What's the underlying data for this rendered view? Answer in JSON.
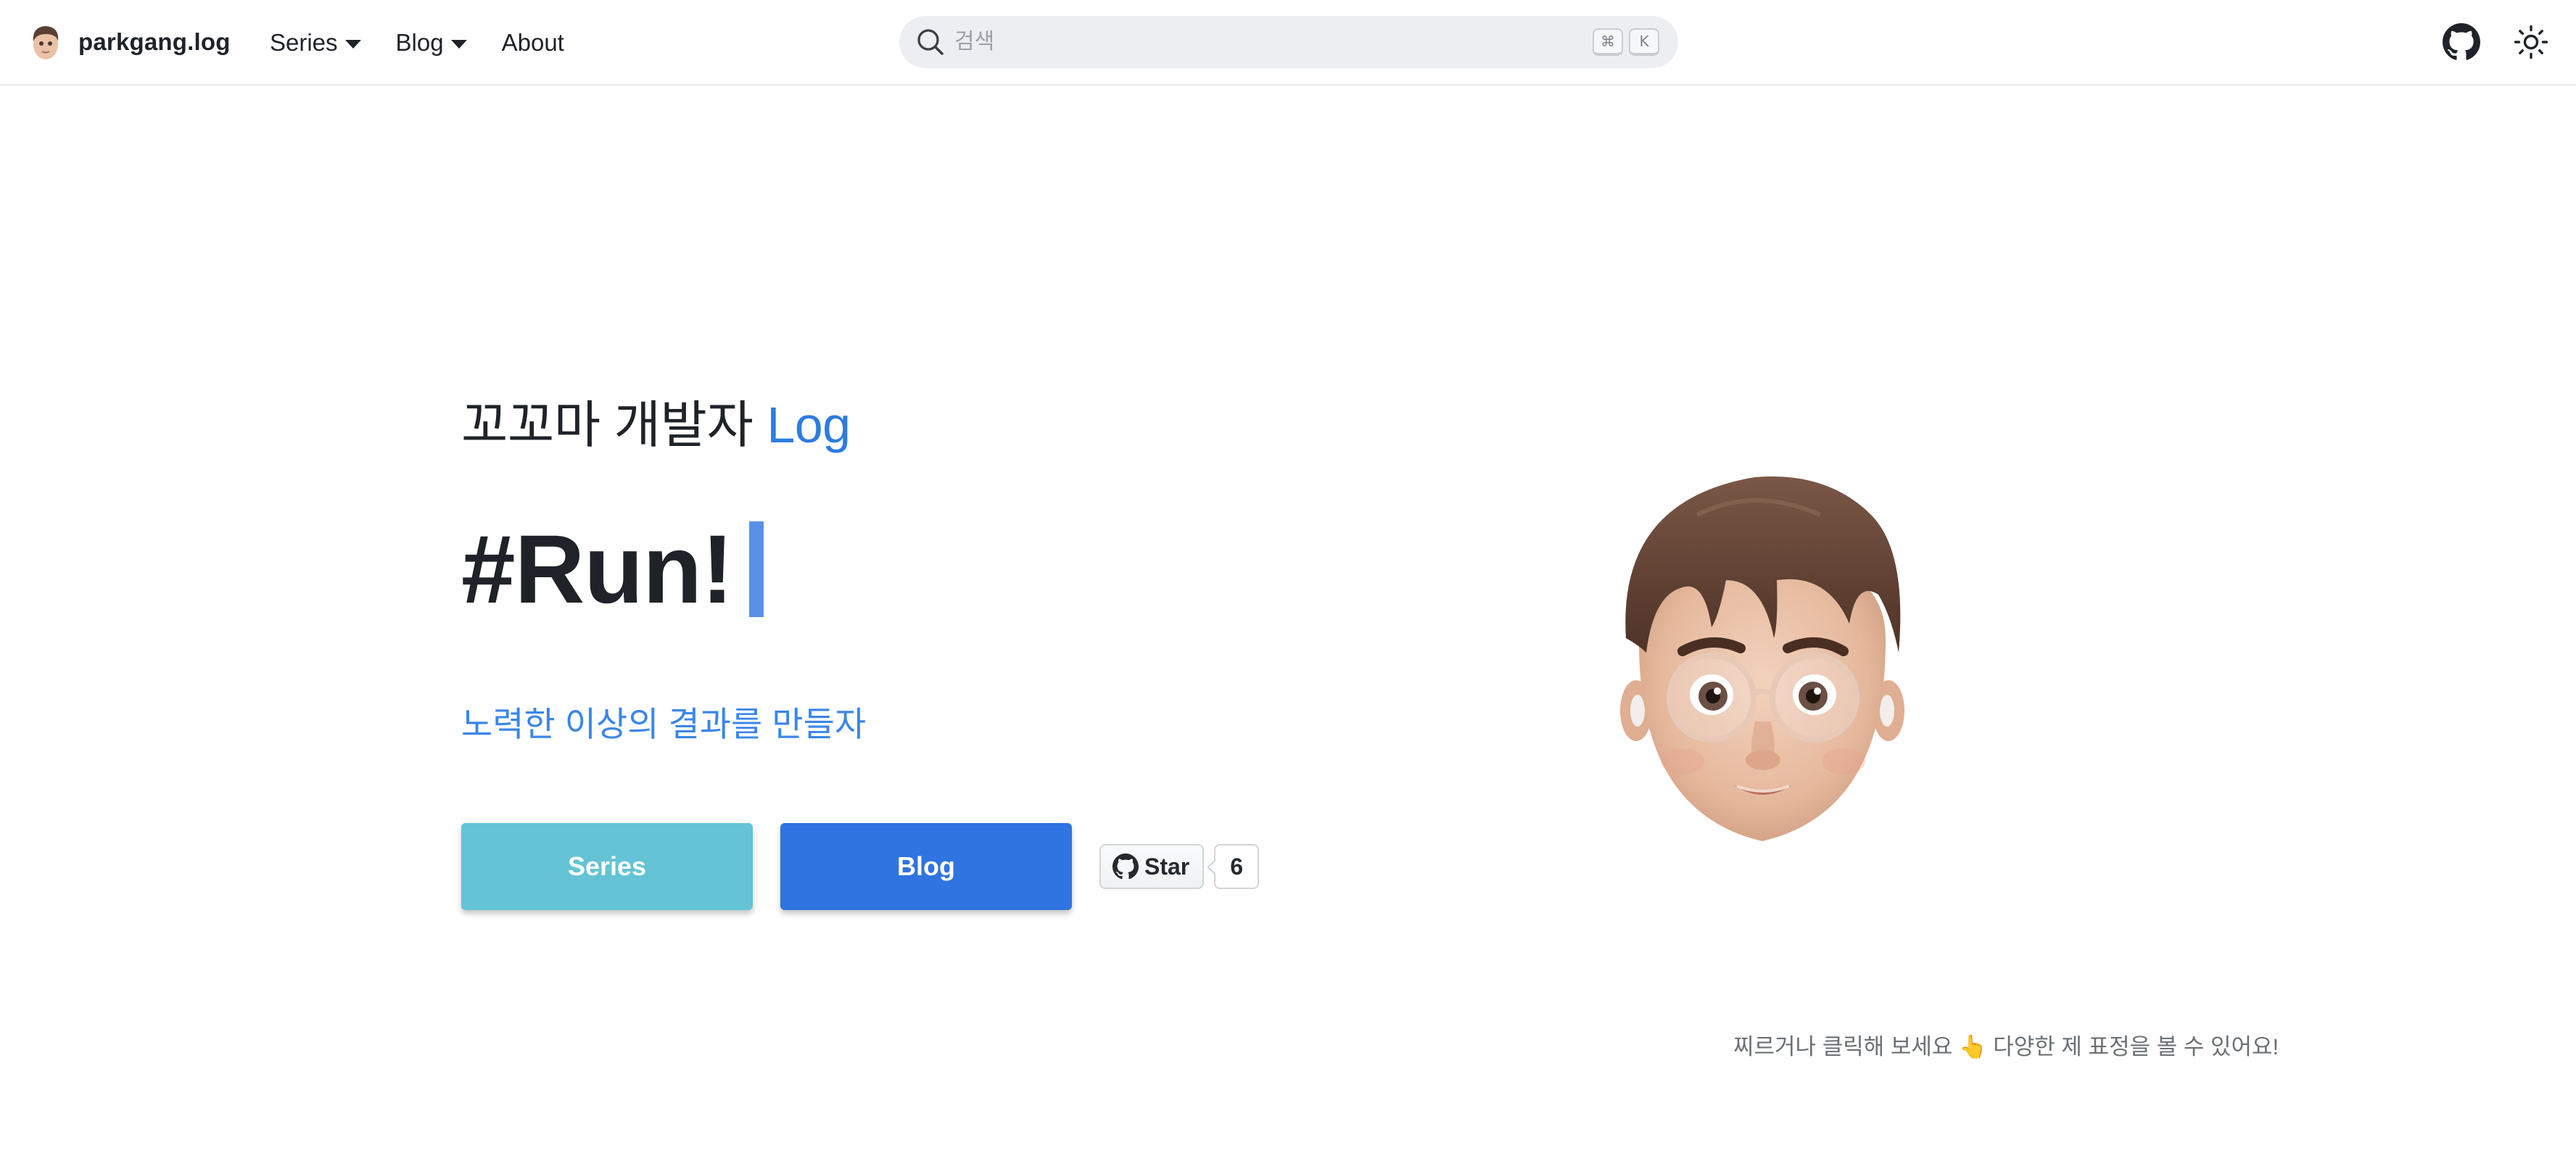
{
  "header": {
    "brand_name": "parkgang.log",
    "nav": [
      {
        "label": "Series",
        "has_dropdown": true
      },
      {
        "label": "Blog",
        "has_dropdown": true
      },
      {
        "label": "About",
        "has_dropdown": false
      }
    ],
    "search": {
      "placeholder": "검색",
      "shortcut_keys": [
        "⌘",
        "K"
      ]
    },
    "icons": [
      "github-icon",
      "sun-icon"
    ]
  },
  "hero": {
    "subtitle_prefix": "꼬꼬마 개발자",
    "subtitle_accent": "Log",
    "title": "#Run!",
    "tagline": "노력한 이상의 결과를 만들자",
    "buttons": {
      "series": "Series",
      "blog": "Blog"
    },
    "github_star": {
      "label": "Star",
      "count": "6"
    },
    "hint": "찌르거나 클릭해 보세요 👆 다양한 제 표정을 볼 수 있어요!"
  },
  "colors": {
    "accent_blue": "#2f7be0",
    "button_series": "#64c3d4",
    "button_blog": "#2f74e1",
    "cursor": "#5a8fe6"
  }
}
